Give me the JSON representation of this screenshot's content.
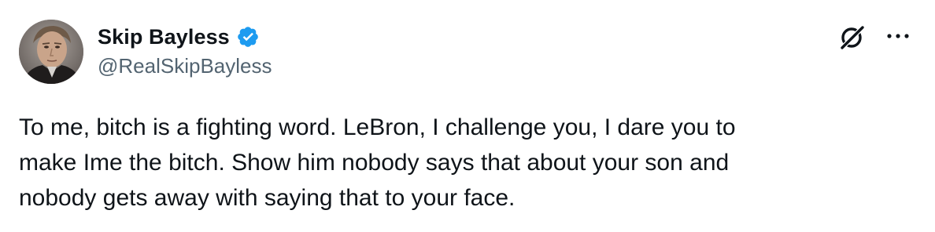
{
  "author": {
    "display_name": "Skip Bayless",
    "handle": "@RealSkipBayless",
    "verified": true
  },
  "icons": {
    "verified": "verified-badge-icon",
    "grok": "grok-icon",
    "more": "more-options-icon"
  },
  "colors": {
    "verified_blue": "#1d9bf0",
    "handle_gray": "#536471",
    "text": "#0f1419"
  },
  "tweet": {
    "text": "To me, bitch is a fighting word. LeBron, I challenge you, I dare you to\nmake Ime the bitch. Show him nobody says that about your son and\nnobody gets away with saying that to your face."
  }
}
